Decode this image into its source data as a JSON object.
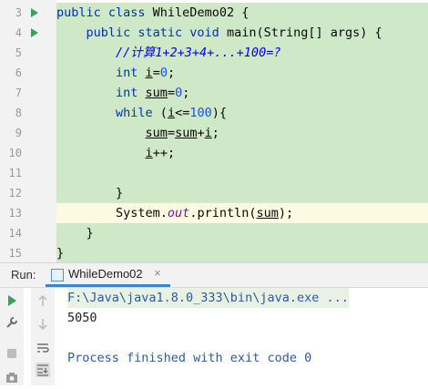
{
  "editor": {
    "lines": [
      {
        "num": "3",
        "tokens": [
          {
            "t": "public class ",
            "c": "kw"
          },
          {
            "t": "WhileDemo02 {",
            "c": ""
          }
        ]
      },
      {
        "num": "4",
        "tokens": [
          {
            "t": "    public static void ",
            "c": "kw"
          },
          {
            "t": "main(String[] args) {",
            "c": ""
          }
        ]
      },
      {
        "num": "5",
        "tokens": [
          {
            "t": "        //计算1+2+3+4+...+100=?",
            "c": "cm"
          }
        ]
      },
      {
        "num": "6",
        "tokens": [
          {
            "t": "        int ",
            "c": "kw"
          },
          {
            "t": "i",
            "c": "var"
          },
          {
            "t": "=",
            "c": ""
          },
          {
            "t": "0",
            "c": "num"
          },
          {
            "t": ";",
            "c": ""
          }
        ]
      },
      {
        "num": "7",
        "tokens": [
          {
            "t": "        int ",
            "c": "kw"
          },
          {
            "t": "sum",
            "c": "var"
          },
          {
            "t": "=",
            "c": ""
          },
          {
            "t": "0",
            "c": "num"
          },
          {
            "t": ";",
            "c": ""
          }
        ]
      },
      {
        "num": "8",
        "tokens": [
          {
            "t": "        while ",
            "c": "kw"
          },
          {
            "t": "(",
            "c": ""
          },
          {
            "t": "i",
            "c": "var"
          },
          {
            "t": "<=",
            "c": ""
          },
          {
            "t": "100",
            "c": "num"
          },
          {
            "t": "){",
            "c": ""
          }
        ]
      },
      {
        "num": "9",
        "tokens": [
          {
            "t": "            ",
            "c": ""
          },
          {
            "t": "sum",
            "c": "var"
          },
          {
            "t": "=",
            "c": ""
          },
          {
            "t": "sum",
            "c": "var"
          },
          {
            "t": "+",
            "c": ""
          },
          {
            "t": "i",
            "c": "var"
          },
          {
            "t": ";",
            "c": ""
          }
        ]
      },
      {
        "num": "10",
        "tokens": [
          {
            "t": "            ",
            "c": ""
          },
          {
            "t": "i",
            "c": "var"
          },
          {
            "t": "++;",
            "c": ""
          }
        ]
      },
      {
        "num": "11",
        "tokens": []
      },
      {
        "num": "12",
        "tokens": [
          {
            "t": "        }",
            "c": ""
          }
        ]
      },
      {
        "num": "13",
        "tokens": [
          {
            "t": "        System.",
            "c": ""
          },
          {
            "t": "out",
            "c": "fld"
          },
          {
            "t": ".println(",
            "c": ""
          },
          {
            "t": "sum",
            "c": "var"
          },
          {
            "t": ");",
            "c": ""
          }
        ]
      },
      {
        "num": "14",
        "tokens": [
          {
            "t": "    }",
            "c": ""
          }
        ]
      },
      {
        "num": "15",
        "tokens": [
          {
            "t": "}",
            "c": ""
          }
        ]
      }
    ],
    "run_markers": [
      "3",
      "4"
    ],
    "highlight_current_line": "13"
  },
  "run_panel": {
    "label": "Run:",
    "tab_label": "WhileDemo02",
    "tab_close": "×"
  },
  "console": {
    "command": "F:\\Java\\java1.8.0_333\\bin\\java.exe ...",
    "output": "5050",
    "finished": "Process finished with exit code 0"
  },
  "colors": {
    "keyword": "#0033b3",
    "comment": "#0000ff",
    "number": "#1750eb",
    "field": "#871094",
    "green_highlight": "#cfe8c7",
    "console_text_blue": "#2d5aa0"
  },
  "icons": {
    "rerun": "play-icon",
    "settings": "wrench-icon",
    "stop": "stop-icon",
    "screenshot": "camera-icon",
    "up": "arrow-up-icon",
    "down": "arrow-down-icon",
    "soft_wrap": "soft-wrap-icon",
    "scroll_end": "scroll-to-end-icon"
  }
}
